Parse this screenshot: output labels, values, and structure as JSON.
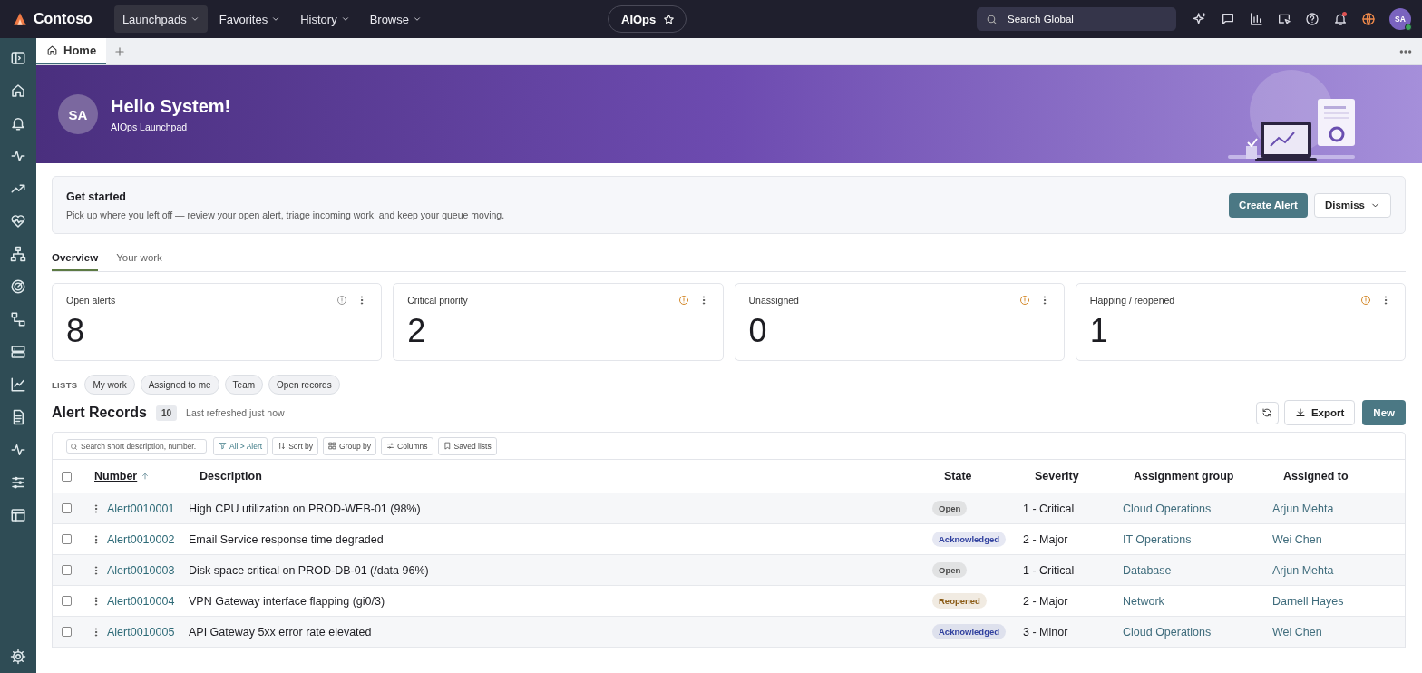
{
  "topbar": {
    "brand": "Contoso",
    "nav": [
      {
        "label": "Launchpads",
        "selected": true
      },
      {
        "label": "Favorites",
        "selected": false
      },
      {
        "label": "History",
        "selected": false
      },
      {
        "label": "Browse",
        "selected": false
      }
    ],
    "workspace": "AIOps",
    "search": {
      "placeholder": "Search Global"
    },
    "has_notifications": true,
    "user": {
      "initials": "SA",
      "online": true
    }
  },
  "page_tabs": [
    {
      "label": "Home",
      "selected": true
    }
  ],
  "banner": {
    "initials": "SA",
    "greeting": "Hello System!",
    "subtitle": "AIOps Launchpad"
  },
  "get_started": {
    "title": "Get started",
    "text": "Pick up where you left off — review your open alert, triage incoming work, and keep your queue moving.",
    "primary": "Create Alert",
    "secondary": "Dismiss"
  },
  "tabs": [
    {
      "label": "Overview",
      "selected": true
    },
    {
      "label": "Your work",
      "selected": false
    }
  ],
  "stats": [
    {
      "label": "Open alerts",
      "value": "8",
      "flagged": false
    },
    {
      "label": "Critical priority",
      "value": "2",
      "flagged": true
    },
    {
      "label": "Unassigned",
      "value": "0",
      "flagged": true
    },
    {
      "label": "Flapping / reopened",
      "value": "1",
      "flagged": true
    }
  ],
  "lists": {
    "label": "LISTS",
    "items": [
      "My work",
      "Assigned to me",
      "Team",
      "Open records"
    ]
  },
  "records": {
    "title": "Alert Records",
    "count": "10",
    "refreshed": "Last refreshed just now",
    "export": "Export",
    "new": "New",
    "search": {
      "placeholder": "Search short description, number."
    },
    "toolbar": [
      {
        "kind": "filter",
        "label": "All > Alert"
      },
      {
        "kind": "sort",
        "label": "Sort by"
      },
      {
        "kind": "group",
        "label": "Group by"
      },
      {
        "kind": "columns",
        "label": "Columns"
      },
      {
        "kind": "saved",
        "label": "Saved lists"
      }
    ],
    "all_selected": false,
    "columns": [
      {
        "label": "Number",
        "sorted": true
      },
      {
        "label": "Description",
        "sorted": false
      },
      {
        "label": "State",
        "sorted": false
      },
      {
        "label": "Severity",
        "sorted": false
      },
      {
        "label": "Assignment group",
        "sorted": false
      },
      {
        "label": "Assigned to",
        "sorted": false
      }
    ],
    "rows": [
      {
        "selected": false,
        "number": "Alert0010001",
        "description": "High CPU utilization on PROD-WEB-01 (98%)",
        "state": {
          "text": "Open",
          "color": "#4a4a4a"
        },
        "severity": "1 - Critical",
        "group": "Cloud Operations",
        "assigned": "Arjun Mehta"
      },
      {
        "selected": false,
        "number": "Alert0010002",
        "description": "Email Service response time degraded",
        "state": {
          "text": "Acknowledged",
          "color": "#2f3f9e"
        },
        "severity": "2 - Major",
        "group": "IT Operations",
        "assigned": "Wei Chen"
      },
      {
        "selected": false,
        "number": "Alert0010003",
        "description": "Disk space critical on PROD-DB-01 (/data 96%)",
        "state": {
          "text": "Open",
          "color": "#4a4a4a"
        },
        "severity": "1 - Critical",
        "group": "Database",
        "assigned": "Arjun Mehta"
      },
      {
        "selected": false,
        "number": "Alert0010004",
        "description": "VPN Gateway interface flapping (gi0/3)",
        "state": {
          "text": "Reopened",
          "color": "#8a5a14"
        },
        "severity": "2 - Major",
        "group": "Network",
        "assigned": "Darnell Hayes"
      },
      {
        "selected": false,
        "number": "Alert0010005",
        "description": "API Gateway 5xx error rate elevated",
        "state": {
          "text": "Acknowledged",
          "color": "#2f3f9e"
        },
        "severity": "3 - Minor",
        "group": "Cloud Operations",
        "assigned": "Wei Chen"
      }
    ]
  }
}
